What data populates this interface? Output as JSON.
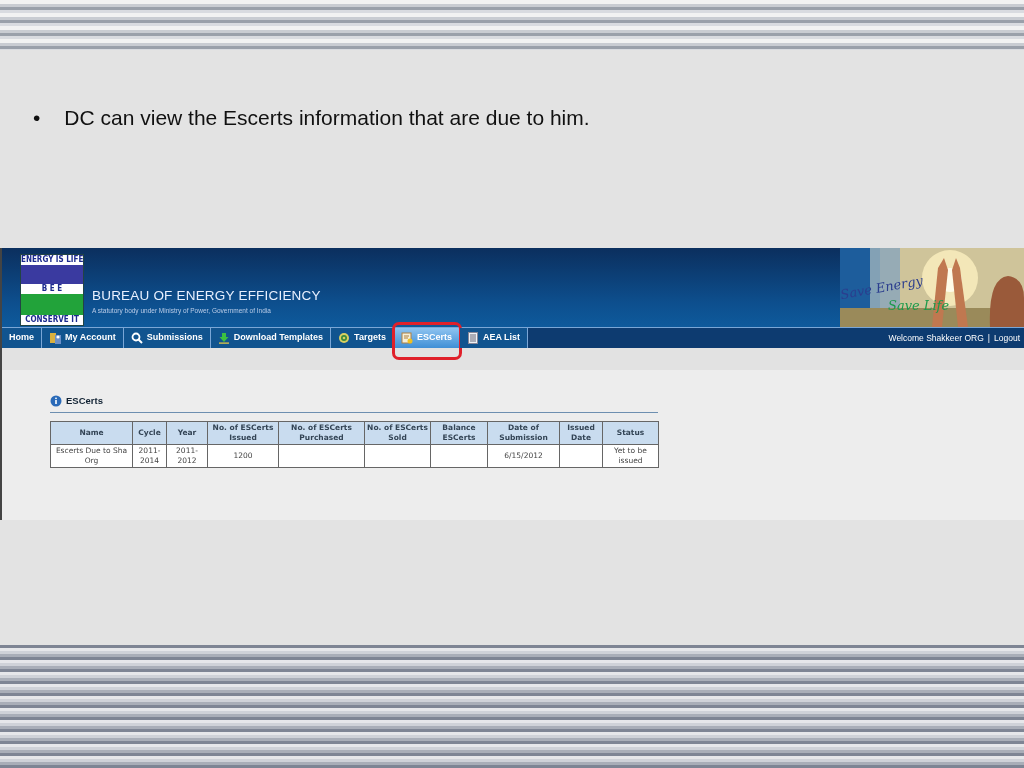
{
  "slide": {
    "bullets": [
      {
        "marker": "•",
        "text": "DC can view the Escerts information that are due to him."
      }
    ]
  },
  "app": {
    "logo": {
      "top": "ENERGY IS LIFE",
      "middle": "B E E",
      "bottom": "CONSERVE IT"
    },
    "org_name": "BUREAU OF ENERGY EFFICIENCY",
    "tagline": "A statutory body under Ministry of Power, Government of India",
    "banner": {
      "line1": "Save Energy",
      "line2": "Save Life"
    },
    "nav": [
      {
        "label": "Home",
        "kind": "plain",
        "selected": false,
        "highlighted": false
      },
      {
        "label": "My Account",
        "kind": "account",
        "selected": false,
        "highlighted": false
      },
      {
        "label": "Submissions",
        "kind": "search",
        "selected": false,
        "highlighted": false
      },
      {
        "label": "Download Templates",
        "kind": "download",
        "selected": false,
        "highlighted": false
      },
      {
        "label": "Targets",
        "kind": "target",
        "selected": false,
        "highlighted": false
      },
      {
        "label": "ESCerts",
        "kind": "certificate",
        "selected": true,
        "highlighted": true
      },
      {
        "label": "AEA List",
        "kind": "list",
        "selected": false,
        "highlighted": false
      }
    ],
    "user": {
      "welcome": "Welcome Shakkeer ORG",
      "separator": "|",
      "logout": "Logout"
    },
    "section": {
      "title": "ESCerts"
    },
    "table": {
      "columns": [
        "Name",
        "Cycle",
        "Year",
        "No. of ESCerts Issued",
        "No. of ESCerts Purchased",
        "No. of ESCerts Sold",
        "Balance ESCerts",
        "Date of Submission",
        "Issued Date",
        "Status"
      ],
      "rows": [
        [
          "Escerts Due to Sha Org",
          "2011-2014",
          "2011-2012",
          "1200",
          null,
          null,
          null,
          "6/15/2012",
          null,
          "Yet to be issued"
        ]
      ]
    }
  }
}
